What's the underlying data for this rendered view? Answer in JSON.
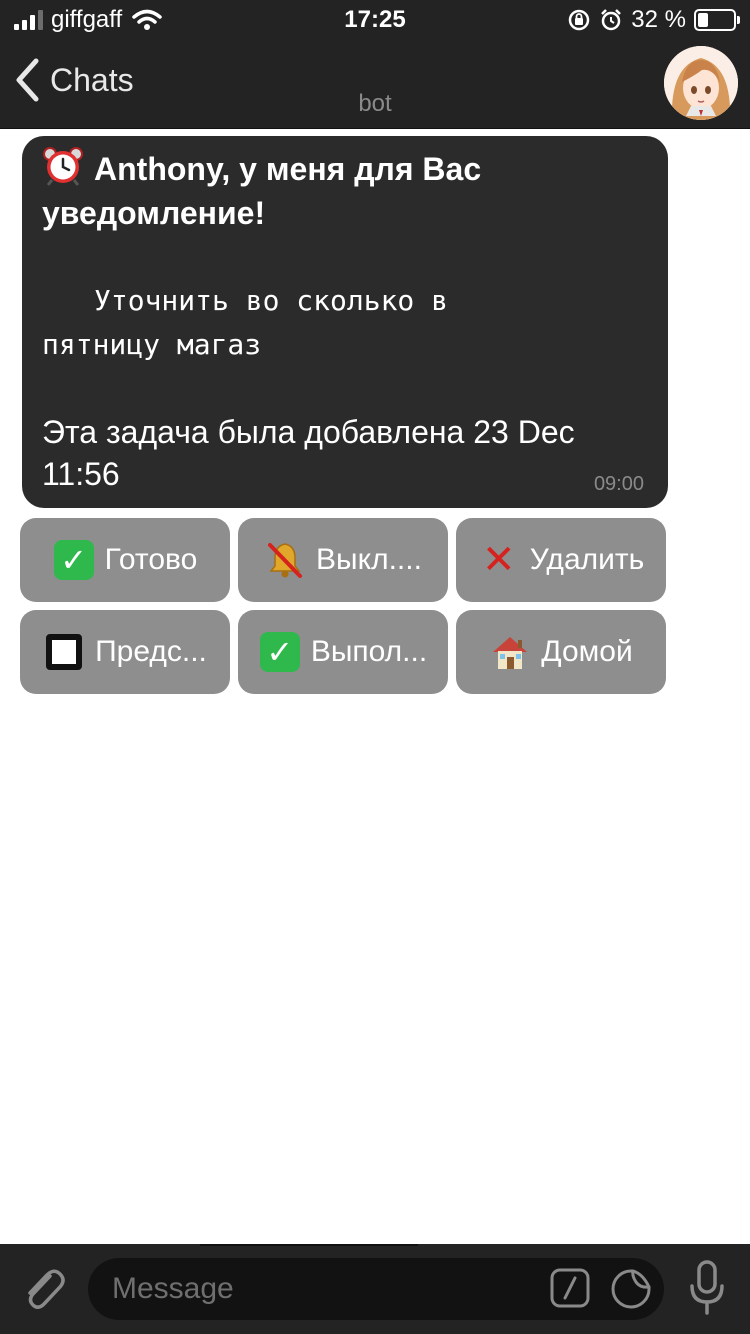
{
  "status_bar": {
    "carrier": "giffgaff",
    "time": "17:25",
    "battery_percent": "32 %",
    "icons": [
      "signal-icon",
      "wifi-icon",
      "orientation-lock-icon",
      "alarm-icon",
      "battery-icon"
    ]
  },
  "nav": {
    "back_label": "Chats",
    "subtitle": "bot",
    "avatar": "bot-avatar"
  },
  "message": {
    "title": "Anthony, у меня для Вас уведомление!",
    "body_line1": "Уточнить во сколько в",
    "body_line2": "пятницу магаз",
    "note": "Эта задача была добавлена 23 Dec 11:56",
    "time": "09:00",
    "icon": "alarm-clock-icon"
  },
  "keyboard": {
    "rows": [
      [
        {
          "label": "Готово",
          "icon": "check-mark-icon"
        },
        {
          "label": "Выкл....",
          "icon": "bell-off-icon"
        },
        {
          "label": "Удалить",
          "icon": "cross-mark-icon"
        }
      ],
      [
        {
          "label": "Предс...",
          "icon": "white-square-icon"
        },
        {
          "label": "Выпол...",
          "icon": "check-mark-icon"
        },
        {
          "label": "Домой",
          "icon": "house-icon"
        }
      ]
    ]
  },
  "input": {
    "placeholder": "Message"
  },
  "colors": {
    "bar_background": "#232324",
    "bubble_background": "#2b2b2c",
    "button_background": "#8e8e8e",
    "chat_background": "#ffffff",
    "check_green": "#2fb94c",
    "cross_red": "#d6221e"
  }
}
